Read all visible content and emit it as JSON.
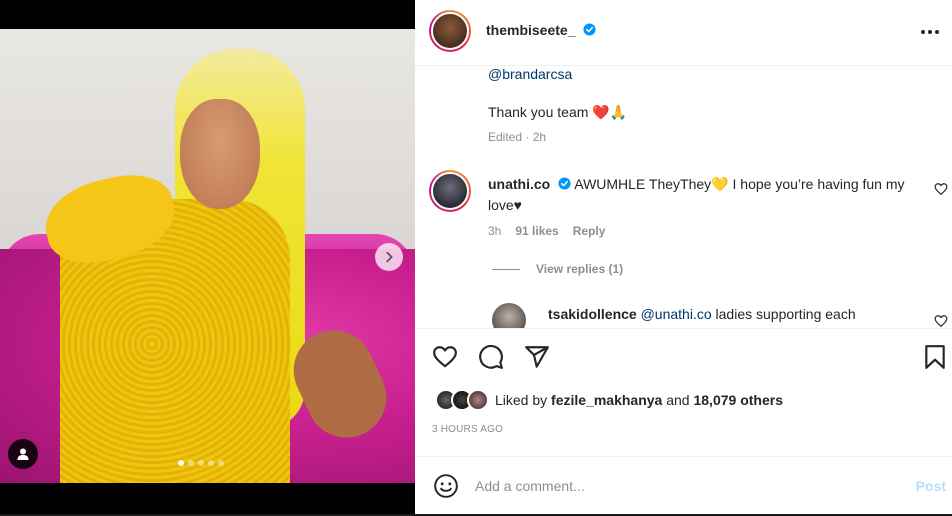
{
  "post": {
    "author": "thembiseete_",
    "more_label": "More options"
  },
  "caption": {
    "mention": "@brandarcsa",
    "thanks": "Thank you team",
    "thanks_emoji": "❤️🙏",
    "edited": "Edited",
    "edited_time": "2h"
  },
  "comment": {
    "username": "unathi.co",
    "text_part1": "AWUMHLE TheyThey",
    "emoji": "💛",
    "text_part2": "I hope you’re having fun my love♥",
    "time": "3h",
    "likes": "91 likes",
    "reply_label": "Reply",
    "view_replies": "View replies (1)"
  },
  "reply": {
    "username": "tsakidollence",
    "mention": "@unathi.co",
    "text": "ladies supporting each"
  },
  "likes": {
    "prefix": "Liked by",
    "first_user": "fezile_makhanya",
    "connector": "and",
    "others": "18,079 others"
  },
  "time_ago": "3 HOURS AGO",
  "add_comment": {
    "placeholder": "Add a comment...",
    "post_label": "Post"
  },
  "carousel": {
    "total_slides": 5,
    "active_slide": 1
  },
  "colors": {
    "verified": "#0095f6",
    "link": "#00376b",
    "post_disabled": "#b2dffc"
  },
  "icons": [
    "verified-icon",
    "more-icon",
    "chevron-right-icon",
    "user-tag-icon",
    "heart-icon",
    "comment-icon",
    "share-icon",
    "bookmark-icon",
    "emoji-icon"
  ]
}
